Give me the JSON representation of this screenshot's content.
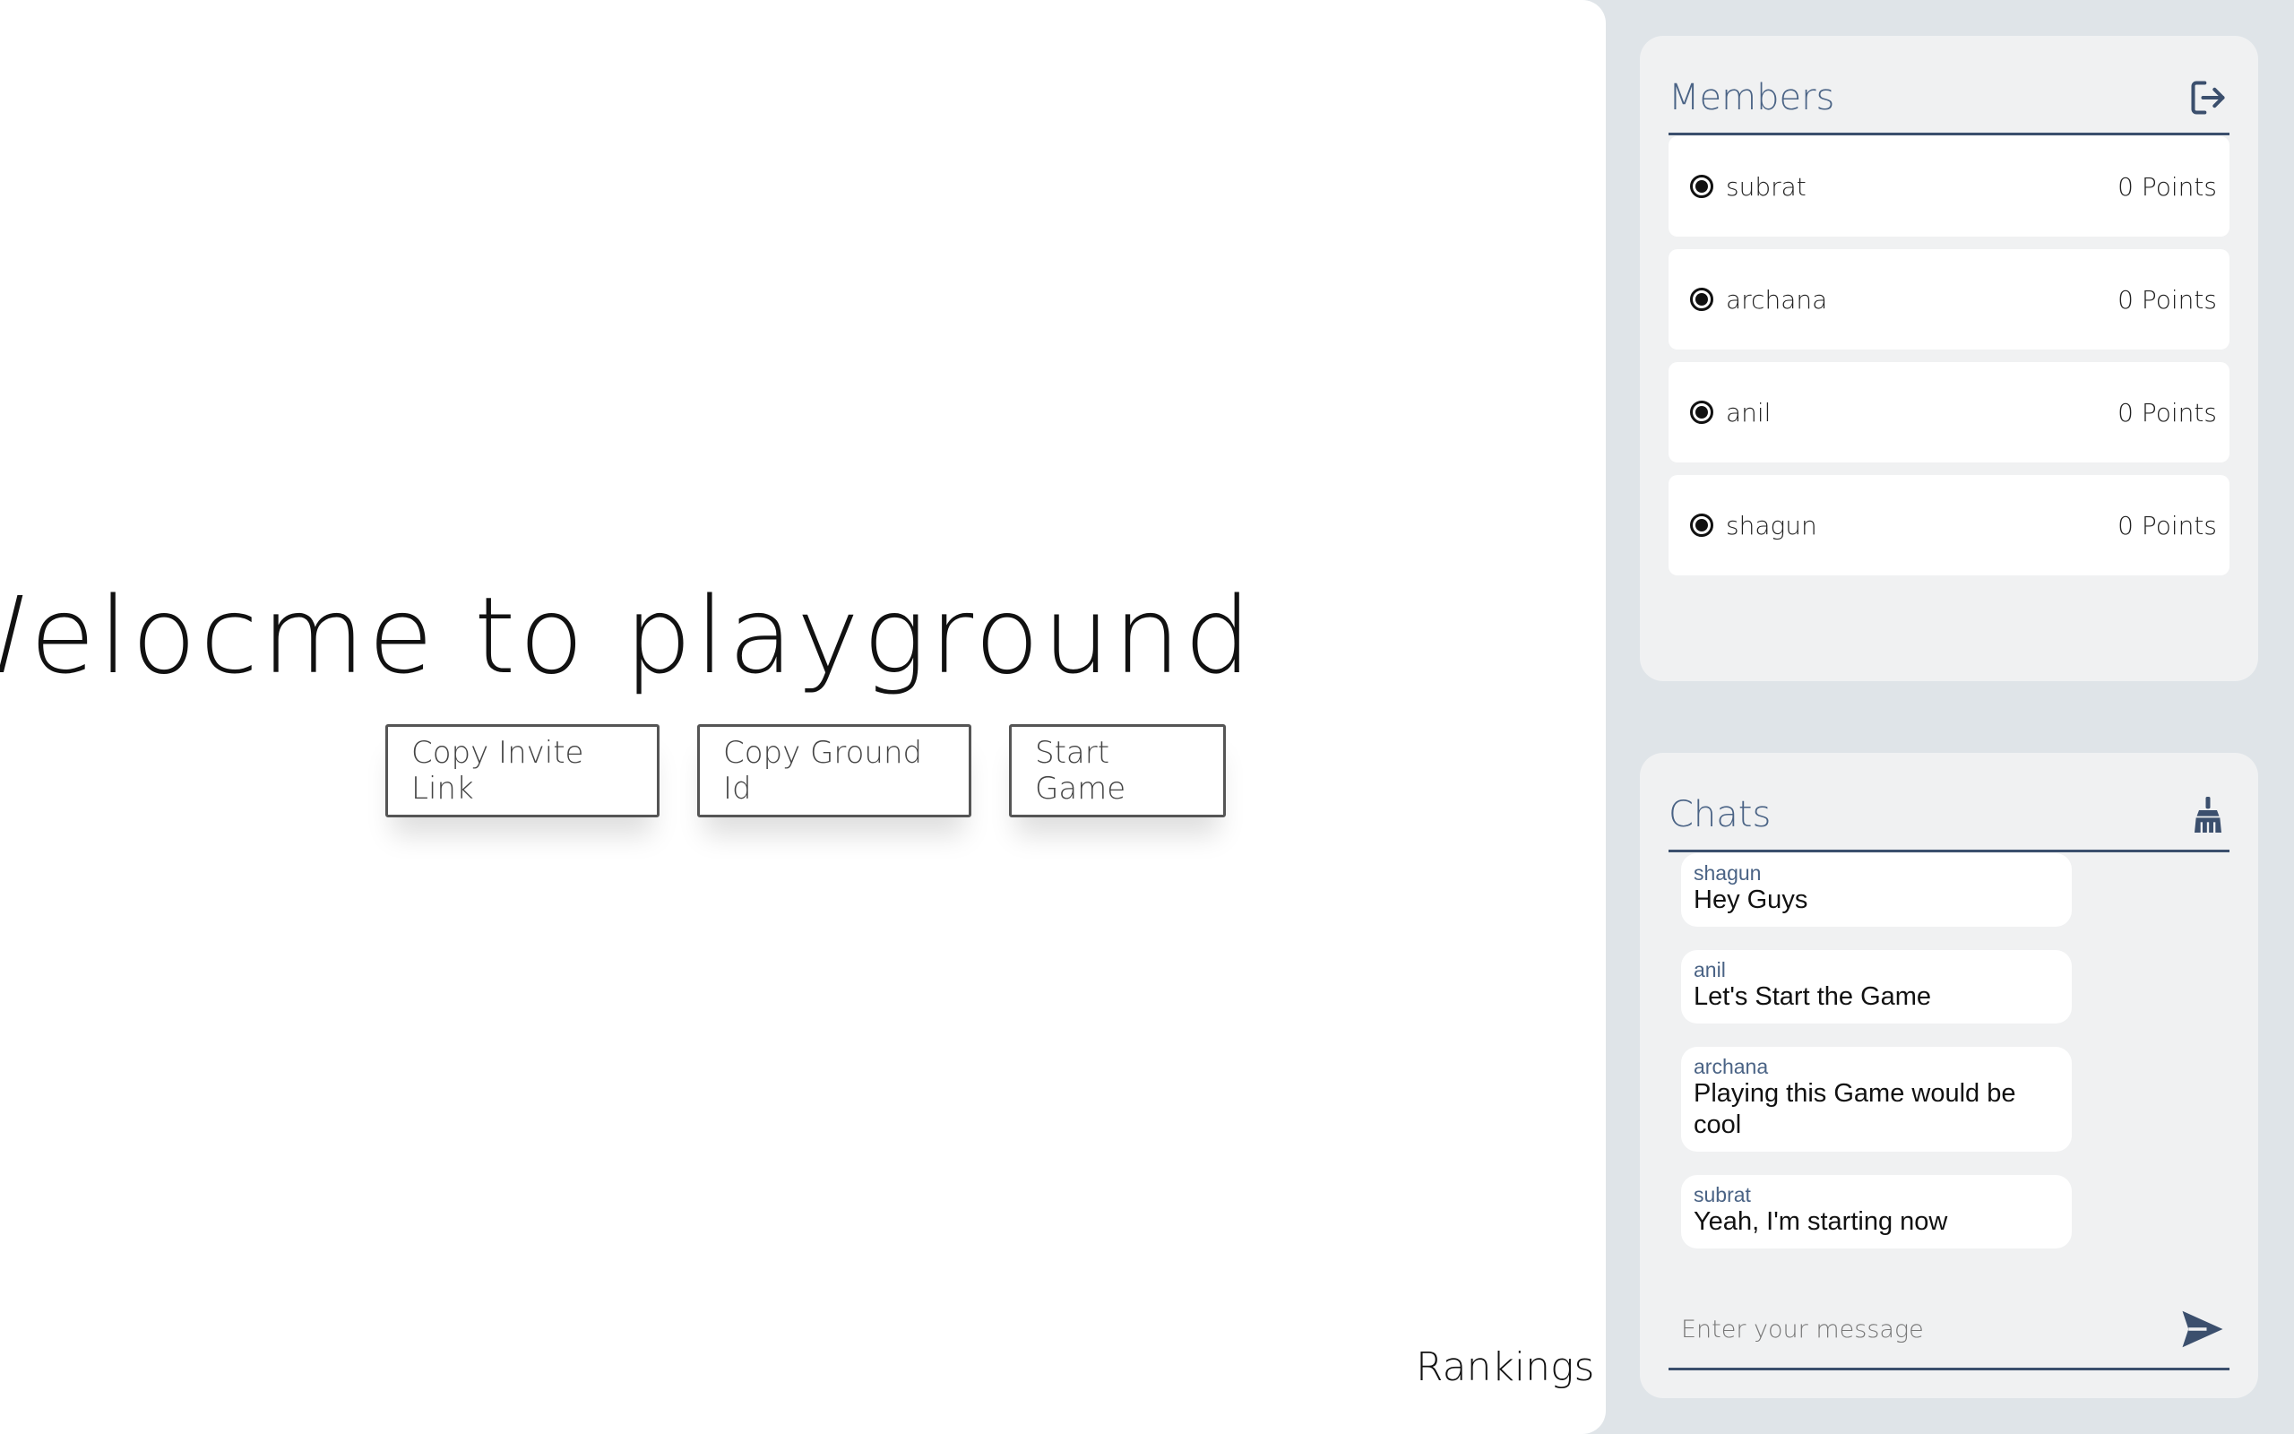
{
  "stage": {
    "welcome_text": "Welocme to playground",
    "buttons": {
      "copy_invite": "Copy Invite Link",
      "copy_ground": "Copy Ground Id",
      "start_game": "Start Game"
    },
    "rankings_label": "Rankings"
  },
  "members": {
    "title": "Members",
    "leave_icon": "logout-icon",
    "items": [
      {
        "name": "subrat",
        "points": "0 Points"
      },
      {
        "name": "archana",
        "points": "0 Points"
      },
      {
        "name": "anil",
        "points": "0 Points"
      },
      {
        "name": "shagun",
        "points": "0 Points"
      }
    ]
  },
  "chats": {
    "title": "Chats",
    "clear_icon": "broom-icon",
    "messages": [
      {
        "user": "shagun",
        "text": "Hey Guys"
      },
      {
        "user": "anil",
        "text": "Let's Start the Game"
      },
      {
        "user": "archana",
        "text": "Playing this Game would be cool"
      },
      {
        "user": "subrat",
        "text": "Yeah, I'm starting now"
      }
    ],
    "input_placeholder": "Enter your message",
    "send_icon": "send-icon"
  },
  "colors": {
    "accent": "#4a6385",
    "panel_bg": "#f0f1f2",
    "page_bg": "#dfe4e8"
  }
}
